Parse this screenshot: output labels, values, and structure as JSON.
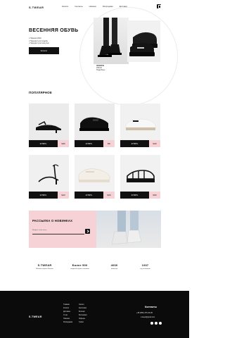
{
  "header": {
    "logo": "S.TWEAR",
    "nav": [
      "Каталог",
      "Контакты",
      "Новинки",
      "Распродажа",
      "Доставка"
    ]
  },
  "hero": {
    "title": "ВЕСЕННЯЯ ОБУВЬ",
    "bullets": [
      "Новинки 2022",
      "Подходит для ходьбы",
      "Подходит для прогулок"
    ],
    "button": "Каталог",
    "caption_title": "ЛОФЕРЫ",
    "caption_lines": [
      "1500 ₽",
      "Подробнее"
    ]
  },
  "popular": {
    "title": "ПОПУЛЯРНОЕ",
    "products": [
      {
        "buy": "КУПИТЬ",
        "price": "$180"
      },
      {
        "buy": "КУПИТЬ",
        "price": "$90"
      },
      {
        "buy": "КУПИТЬ",
        "price": "$100"
      },
      {
        "buy": "КУПИТЬ",
        "price": "$120"
      },
      {
        "buy": "КУПИТЬ",
        "price": "$130"
      },
      {
        "buy": "КУПИТЬ",
        "price": "$150"
      }
    ]
  },
  "newsletter": {
    "title": "РАССЫЛКА О НОВИНКАХ",
    "placeholder": "Введите свою почту"
  },
  "stats": [
    {
      "value": "S.TWEAR",
      "desc": "Магазин обуви в Москве"
    },
    {
      "value": "Более 500",
      "desc": "моделей обуви в наличии"
    },
    {
      "value": "4000",
      "desc": "клиентов"
    },
    {
      "value": "1937",
      "desc": "год основания"
    }
  ],
  "footer": {
    "logo": "S.TWEAR",
    "col1": [
      "Главная",
      "Каталог",
      "Доставка",
      "О нас",
      "Новинки",
      "Распродажа"
    ],
    "col2": [
      "Сапоги",
      "Кроссовки",
      "Ботинки",
      "Босоножки",
      "Лоферы",
      "Туфли"
    ],
    "contacts_title": "Контакты",
    "phone": "+38 (380) 376-34-99",
    "email": "s.twear@gmail.com"
  },
  "colors": {
    "accent_pink": "#f6d2d6",
    "dark": "#111111",
    "card_bg": "#ebebeb"
  }
}
